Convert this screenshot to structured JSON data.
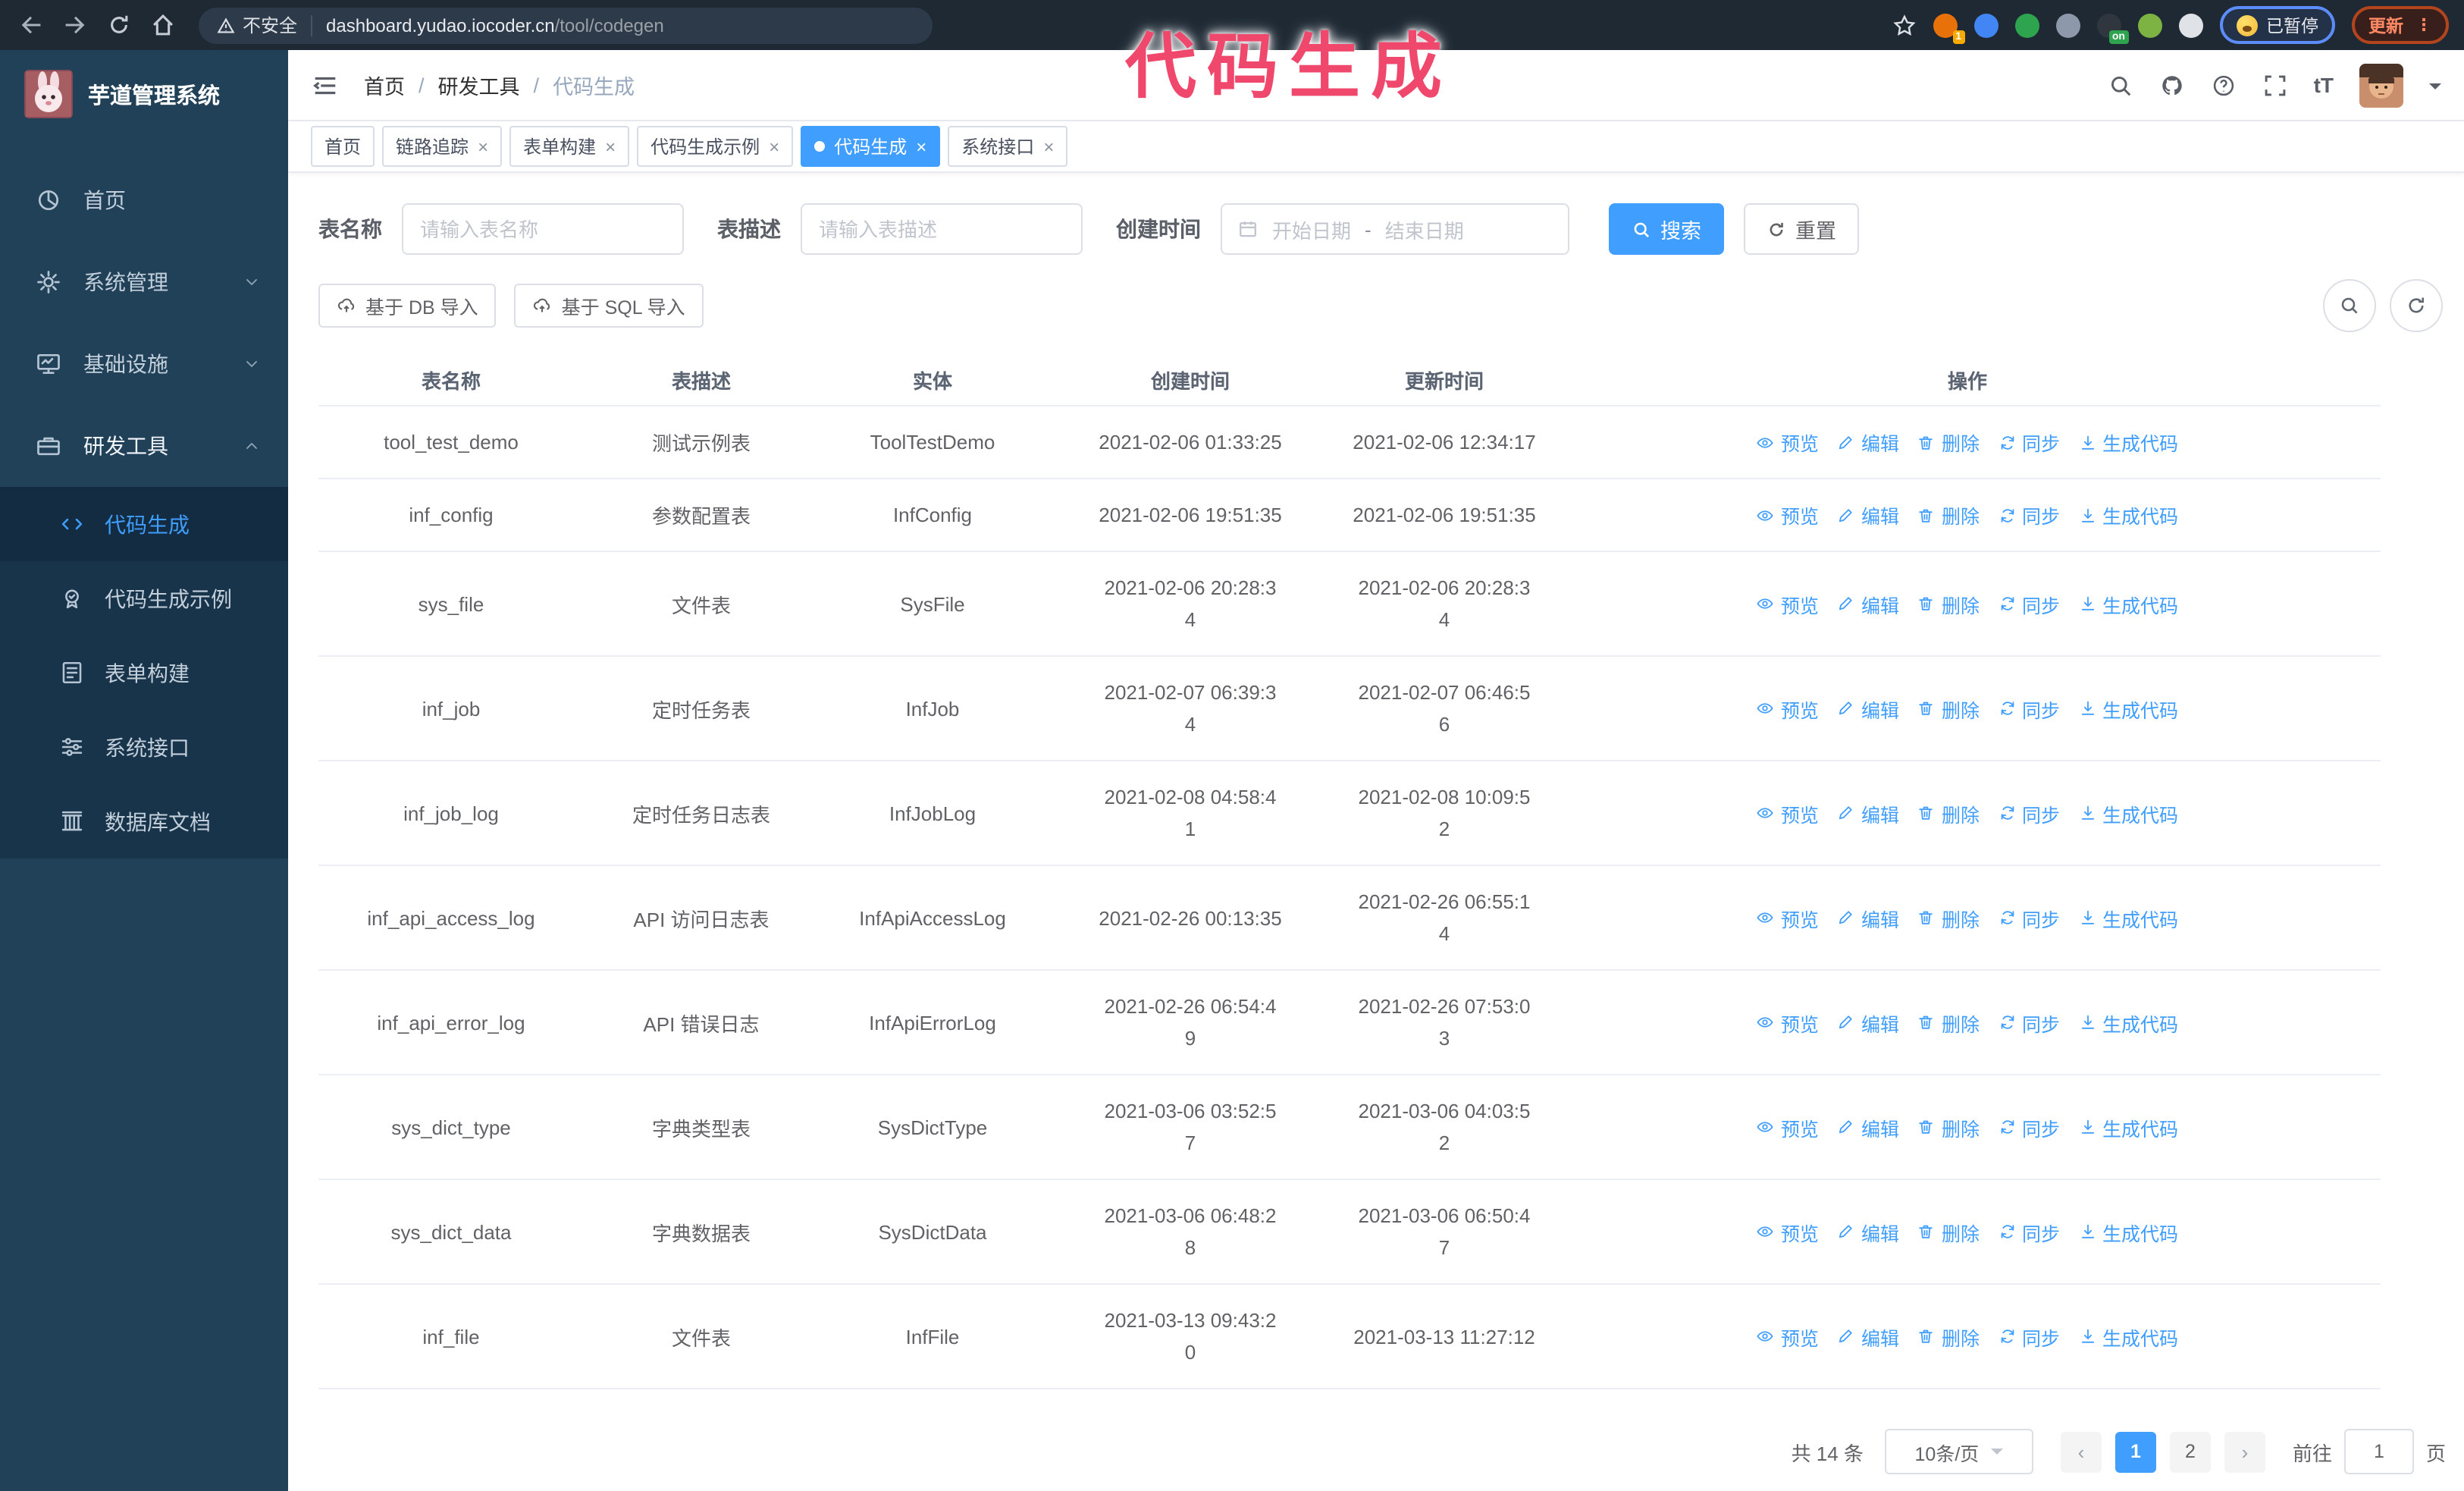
{
  "colors": {
    "accent": "#409eff",
    "sidebar_bg": "#214158",
    "submenu_bg": "#17344a",
    "annotation_pink": "#f0476d",
    "chrome_bg": "#1e2934"
  },
  "browser": {
    "security_label": "不安全",
    "url_host": "dashboard.yudao.iocoder.cn",
    "url_path": "/tool/codegen",
    "profile_status": "已暂停",
    "update_label": "更新",
    "menu_dots": "⋮",
    "extensions": [
      {
        "name": "extension-orange-c",
        "color": "#e8710a",
        "badge": "1",
        "badge_color": "#f9ab00"
      },
      {
        "name": "extension-blue-gem",
        "color": "#4285f4",
        "badge": "",
        "badge_color": ""
      },
      {
        "name": "extension-green-check",
        "color": "#2ea44f",
        "badge": "",
        "badge_color": ""
      },
      {
        "name": "extension-grid",
        "color": "#8d99ab",
        "badge": "",
        "badge_color": ""
      },
      {
        "name": "extension-dark-on",
        "color": "#30363d",
        "badge": "on",
        "badge_color": "#2ea44f"
      },
      {
        "name": "extension-green-bot",
        "color": "#7cb342",
        "badge": "",
        "badge_color": ""
      },
      {
        "name": "extension-puzzle",
        "color": "#dfe3e8",
        "badge": "",
        "badge_color": ""
      }
    ]
  },
  "annotation": {
    "text": "代码生成"
  },
  "sidebar": {
    "app_title": "芋道管理系统",
    "items": [
      {
        "key": "home",
        "label": "首页",
        "icon": "dashboard-icon",
        "chevron": "",
        "expanded": false
      },
      {
        "key": "system",
        "label": "系统管理",
        "icon": "gear-icon",
        "chevron": "down",
        "expanded": false
      },
      {
        "key": "infra",
        "label": "基础设施",
        "icon": "monitor-icon",
        "chevron": "down",
        "expanded": false
      },
      {
        "key": "devtools",
        "label": "研发工具",
        "icon": "toolbox-icon",
        "chevron": "up",
        "expanded": true
      }
    ],
    "submenu": [
      {
        "key": "codegen",
        "label": "代码生成",
        "icon": "code-icon",
        "active": true
      },
      {
        "key": "codegen-example",
        "label": "代码生成示例",
        "icon": "example-icon",
        "active": false
      },
      {
        "key": "form-builder",
        "label": "表单构建",
        "icon": "form-icon",
        "active": false
      },
      {
        "key": "system-api",
        "label": "系统接口",
        "icon": "api-icon",
        "active": false
      },
      {
        "key": "db-doc",
        "label": "数据库文档",
        "icon": "db-doc-icon",
        "active": false
      }
    ]
  },
  "header": {
    "breadcrumb": [
      "首页",
      "研发工具",
      "代码生成"
    ],
    "separator": "/"
  },
  "tabs": [
    {
      "label": "首页",
      "closable": false,
      "active": false
    },
    {
      "label": "链路追踪",
      "closable": true,
      "active": false
    },
    {
      "label": "表单构建",
      "closable": true,
      "active": false
    },
    {
      "label": "代码生成示例",
      "closable": true,
      "active": false
    },
    {
      "label": "代码生成",
      "closable": true,
      "active": true
    },
    {
      "label": "系统接口",
      "closable": true,
      "active": false
    }
  ],
  "filters": {
    "table_name_label": "表名称",
    "table_name_placeholder": "请输入表名称",
    "table_desc_label": "表描述",
    "table_desc_placeholder": "请输入表描述",
    "create_time_label": "创建时间",
    "date_start_placeholder": "开始日期",
    "date_separator": "-",
    "date_end_placeholder": "结束日期",
    "search_label": "搜索",
    "reset_label": "重置"
  },
  "toolbar": {
    "import_db_label": "基于 DB 导入",
    "import_sql_label": "基于 SQL 导入"
  },
  "table": {
    "columns": [
      "表名称",
      "表描述",
      "实体",
      "创建时间",
      "更新时间",
      "操作"
    ],
    "actions": [
      "预览",
      "编辑",
      "删除",
      "同步",
      "生成代码"
    ],
    "rows": [
      {
        "name": "tool_test_demo",
        "desc": "测试示例表",
        "entity": "ToolTestDemo",
        "created": "2021-02-06 01:33:25",
        "updated": "2021-02-06 12:34:17"
      },
      {
        "name": "inf_config",
        "desc": "参数配置表",
        "entity": "InfConfig",
        "created": "2021-02-06 19:51:35",
        "updated": "2021-02-06 19:51:35"
      },
      {
        "name": "sys_file",
        "desc": "文件表",
        "entity": "SysFile",
        "created": "2021-02-06 20:28:3\n4",
        "updated": "2021-02-06 20:28:3\n4"
      },
      {
        "name": "inf_job",
        "desc": "定时任务表",
        "entity": "InfJob",
        "created": "2021-02-07 06:39:3\n4",
        "updated": "2021-02-07 06:46:5\n6"
      },
      {
        "name": "inf_job_log",
        "desc": "定时任务日志表",
        "entity": "InfJobLog",
        "created": "2021-02-08 04:58:4\n1",
        "updated": "2021-02-08 10:09:5\n2"
      },
      {
        "name": "inf_api_access_log",
        "desc": "API 访问日志表",
        "entity": "InfApiAccessLog",
        "created": "2021-02-26 00:13:35",
        "updated": "2021-02-26 06:55:1\n4"
      },
      {
        "name": "inf_api_error_log",
        "desc": "API 错误日志",
        "entity": "InfApiErrorLog",
        "created": "2021-02-26 06:54:4\n9",
        "updated": "2021-02-26 07:53:0\n3"
      },
      {
        "name": "sys_dict_type",
        "desc": "字典类型表",
        "entity": "SysDictType",
        "created": "2021-03-06 03:52:5\n7",
        "updated": "2021-03-06 04:03:5\n2"
      },
      {
        "name": "sys_dict_data",
        "desc": "字典数据表",
        "entity": "SysDictData",
        "created": "2021-03-06 06:48:2\n8",
        "updated": "2021-03-06 06:50:4\n7"
      },
      {
        "name": "inf_file",
        "desc": "文件表",
        "entity": "InfFile",
        "created": "2021-03-13 09:43:2\n0",
        "updated": "2021-03-13 11:27:12"
      }
    ]
  },
  "pagination": {
    "total_text": "共 14 条",
    "page_size": "10条/页",
    "prev": "‹",
    "next": "›",
    "pages": [
      {
        "label": "1",
        "active": true
      },
      {
        "label": "2",
        "active": false
      }
    ],
    "goto_label": "前往",
    "goto_value": "1",
    "page_suffix": "页"
  }
}
